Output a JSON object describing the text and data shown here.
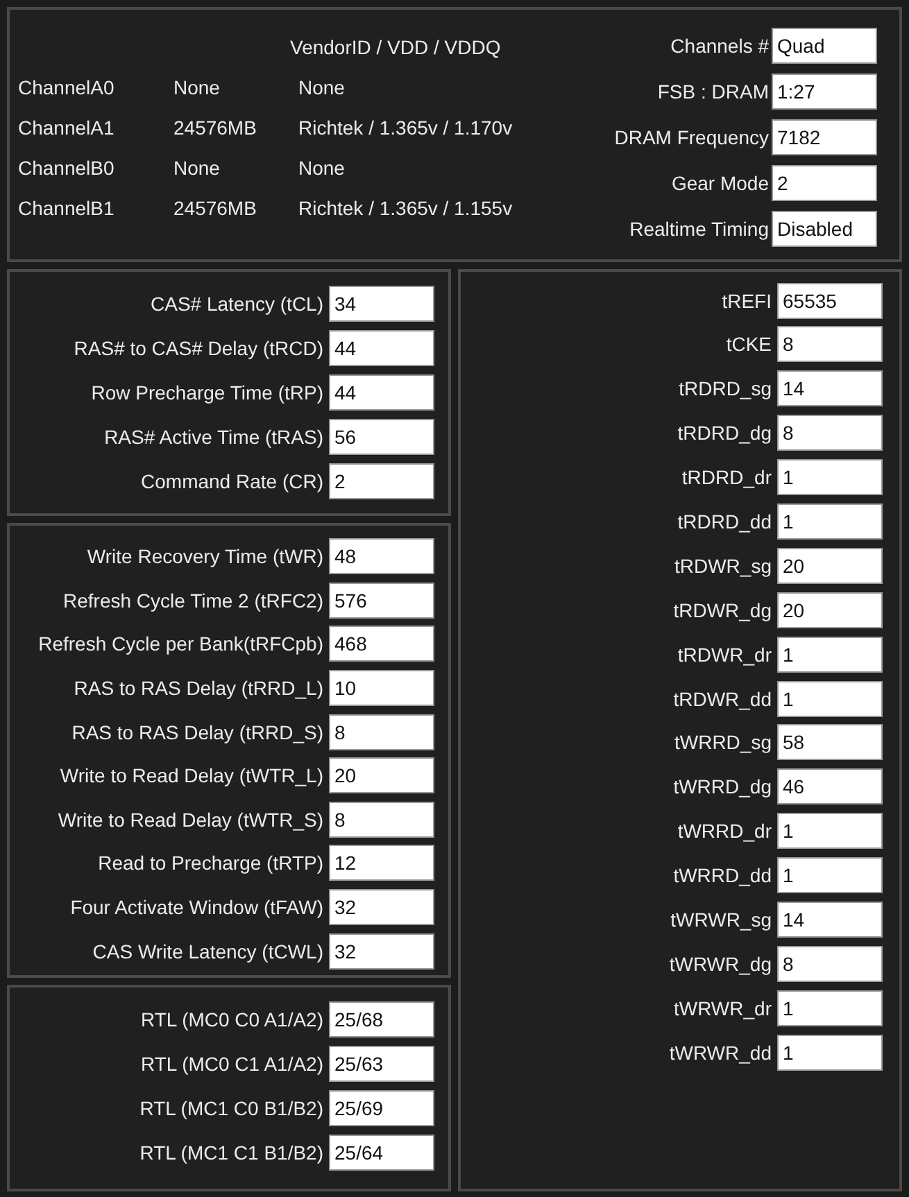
{
  "channels": {
    "header": "VendorID / VDD / VDDQ",
    "rows": [
      {
        "name": "ChannelA0",
        "size": "None",
        "vendor": "None"
      },
      {
        "name": "ChannelA1",
        "size": "24576MB",
        "vendor": "Richtek / 1.365v / 1.170v"
      },
      {
        "name": "ChannelB0",
        "size": "None",
        "vendor": "None"
      },
      {
        "name": "ChannelB1",
        "size": "24576MB",
        "vendor": "Richtek / 1.365v / 1.155v"
      }
    ]
  },
  "summary": [
    {
      "label": "Channels #",
      "value": "Quad"
    },
    {
      "label": "FSB : DRAM",
      "value": "1:27"
    },
    {
      "label": "DRAM Frequency",
      "value": "7182"
    },
    {
      "label": "Gear Mode",
      "value": "2"
    },
    {
      "label": "Realtime Timing",
      "value": "Disabled"
    }
  ],
  "primary_timings": [
    {
      "label": "CAS# Latency (tCL)",
      "value": "34"
    },
    {
      "label": "RAS# to CAS# Delay (tRCD)",
      "value": "44"
    },
    {
      "label": "Row Precharge Time (tRP)",
      "value": "44"
    },
    {
      "label": "RAS# Active Time (tRAS)",
      "value": "56"
    },
    {
      "label": "Command Rate (CR)",
      "value": "2"
    }
  ],
  "secondary_timings": [
    {
      "label": "Write Recovery Time (tWR)",
      "value": "48"
    },
    {
      "label": "Refresh Cycle Time 2 (tRFC2)",
      "value": "576"
    },
    {
      "label": "Refresh Cycle per Bank(tRFCpb)",
      "value": "468"
    },
    {
      "label": "RAS to RAS Delay (tRRD_L)",
      "value": "10"
    },
    {
      "label": "RAS to RAS Delay (tRRD_S)",
      "value": "8"
    },
    {
      "label": "Write to Read Delay (tWTR_L)",
      "value": "20"
    },
    {
      "label": "Write to Read Delay (tWTR_S)",
      "value": "8"
    },
    {
      "label": "Read to Precharge (tRTP)",
      "value": "12"
    },
    {
      "label": "Four Activate Window (tFAW)",
      "value": "32"
    },
    {
      "label": "CAS Write Latency (tCWL)",
      "value": "32"
    }
  ],
  "rtl": [
    {
      "label": "RTL (MC0 C0 A1/A2)",
      "value": "25/68"
    },
    {
      "label": "RTL (MC0 C1 A1/A2)",
      "value": "25/63"
    },
    {
      "label": "RTL (MC1 C0 B1/B2)",
      "value": "25/69"
    },
    {
      "label": "RTL (MC1 C1 B1/B2)",
      "value": "25/64"
    }
  ],
  "tertiary_timings": [
    {
      "label": "tREFI",
      "value": "65535"
    },
    {
      "label": "tCKE",
      "value": "8"
    },
    {
      "label": "tRDRD_sg",
      "value": "14"
    },
    {
      "label": "tRDRD_dg",
      "value": "8"
    },
    {
      "label": "tRDRD_dr",
      "value": "1"
    },
    {
      "label": "tRDRD_dd",
      "value": "1"
    },
    {
      "label": "tRDWR_sg",
      "value": "20"
    },
    {
      "label": "tRDWR_dg",
      "value": "20"
    },
    {
      "label": "tRDWR_dr",
      "value": "1"
    },
    {
      "label": "tRDWR_dd",
      "value": "1"
    },
    {
      "label": "tWRRD_sg",
      "value": "58"
    },
    {
      "label": "tWRRD_dg",
      "value": "46"
    },
    {
      "label": "tWRRD_dr",
      "value": "1"
    },
    {
      "label": "tWRRD_dd",
      "value": "1"
    },
    {
      "label": "tWRWR_sg",
      "value": "14"
    },
    {
      "label": "tWRWR_dg",
      "value": "8"
    },
    {
      "label": "tWRWR_dr",
      "value": "1"
    },
    {
      "label": "tWRWR_dd",
      "value": "1"
    }
  ]
}
